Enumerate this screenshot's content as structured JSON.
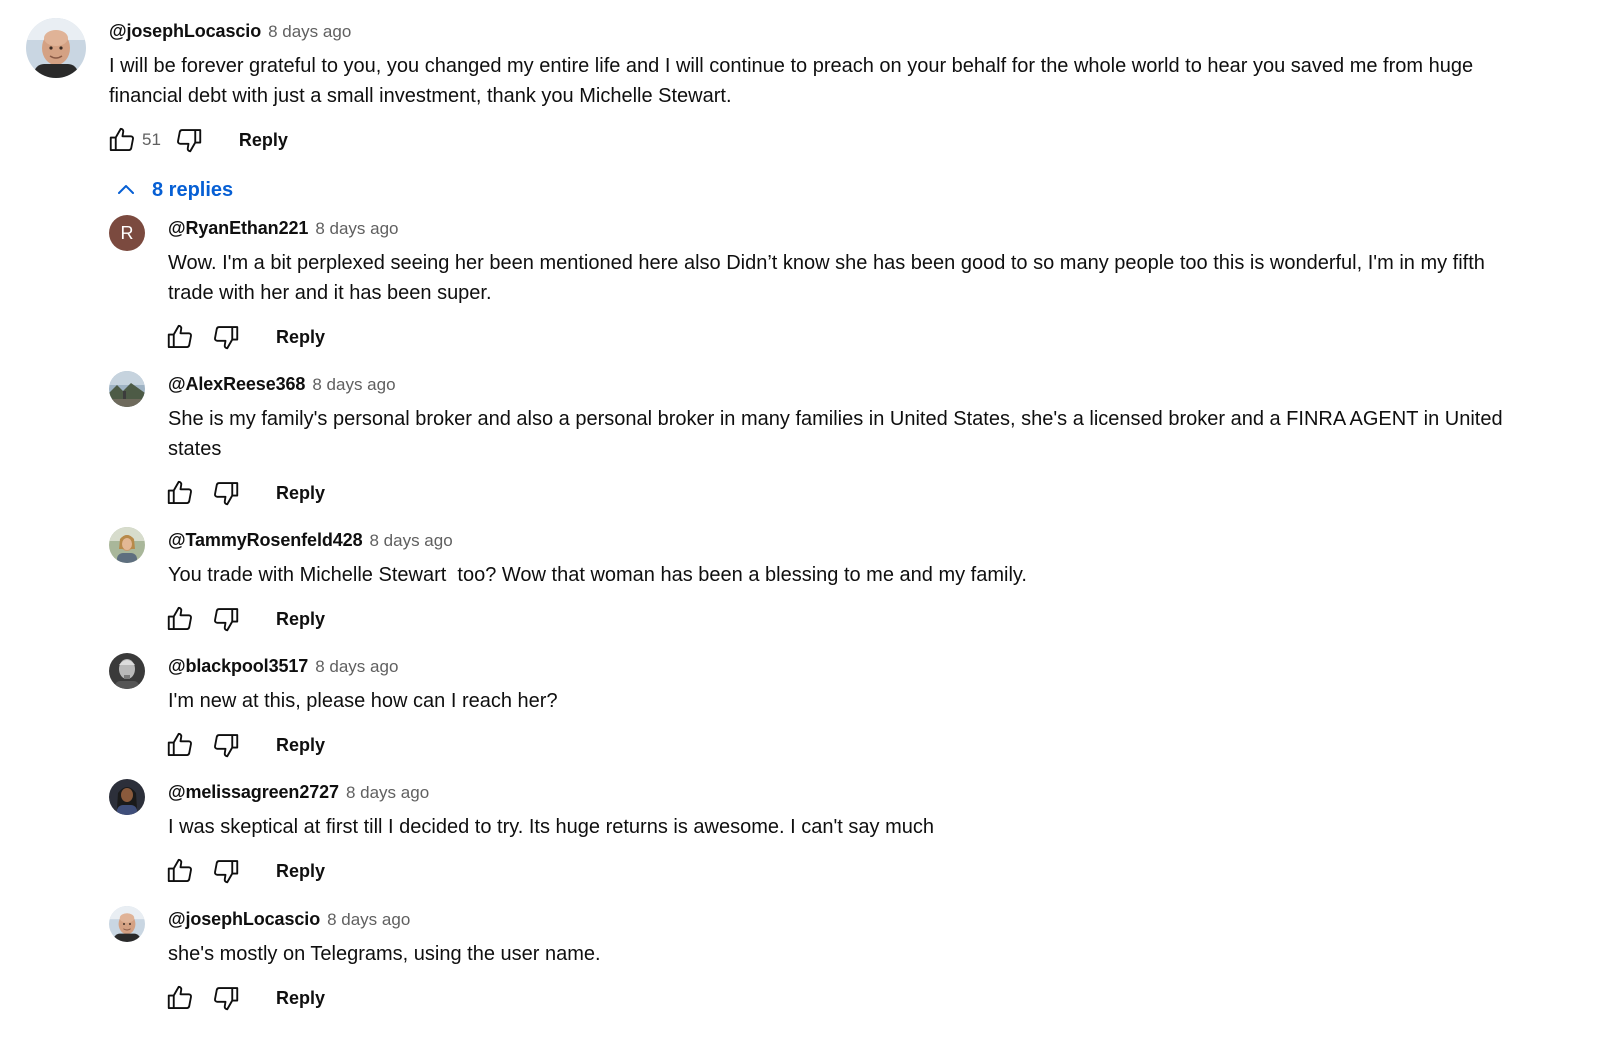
{
  "comment": {
    "author": "@josephLocascio",
    "time": "8 days ago",
    "text_line1": "I will be forever grateful to you, you changed my entire life and I will continue to preach on your behalf for the whole world to hear you saved me from huge",
    "text_line2": "financial debt with just a small investment, thank you Michelle Stewart.",
    "likes": "51",
    "reply_label": "Reply",
    "avatar": "bald-man-avatar"
  },
  "replies_toggle": {
    "label": "8 replies",
    "icon": "chevron-up-icon"
  },
  "replies": [
    {
      "author": "@RyanEthan221",
      "time": "8 days ago",
      "text_line1": "Wow. I'm a bit perplexed seeing her been mentioned here also Didn’t know she has been good to so many people too this is wonderful, I'm in my fifth",
      "text_line2": "trade with her and it has been super.",
      "reply_label": "Reply",
      "avatar_letter": "R",
      "avatar_color": "#7b4a3f"
    },
    {
      "author": "@AlexReese368",
      "time": "8 days ago",
      "text_line1": "She is my family's personal broker and also a personal broker in many families in United States, she's a licensed broker and a FINRA AGENT in United",
      "text_line2": "states",
      "reply_label": "Reply",
      "avatar": "landscape-avatar"
    },
    {
      "author": "@TammyRosenfeld428",
      "time": "8 days ago",
      "text_line1": "You trade with Michelle Stewart  too? Wow that woman has been a blessing to me and my family.",
      "reply_label": "Reply",
      "avatar": "woman-outdoor-avatar"
    },
    {
      "author": "@blackpool3517",
      "time": "8 days ago",
      "text_line1": "I'm new at this, please how can I reach her?",
      "reply_label": "Reply",
      "avatar": "grey-man-avatar"
    },
    {
      "author": "@melissagreen2727",
      "time": "8 days ago",
      "text_line1": "I was skeptical at first till I decided to try. Its huge returns is awesome. I can't say much",
      "reply_label": "Reply",
      "avatar": "woman-dark-avatar"
    },
    {
      "author": "@josephLocascio",
      "time": "8 days ago",
      "text_line1": "she's mostly on Telegrams, using the user name.",
      "reply_label": "Reply",
      "avatar": "bald-man-avatar"
    }
  ],
  "colors": {
    "link_blue": "#065fd4",
    "meta_grey": "#606060",
    "text": "#0f0f0f"
  }
}
